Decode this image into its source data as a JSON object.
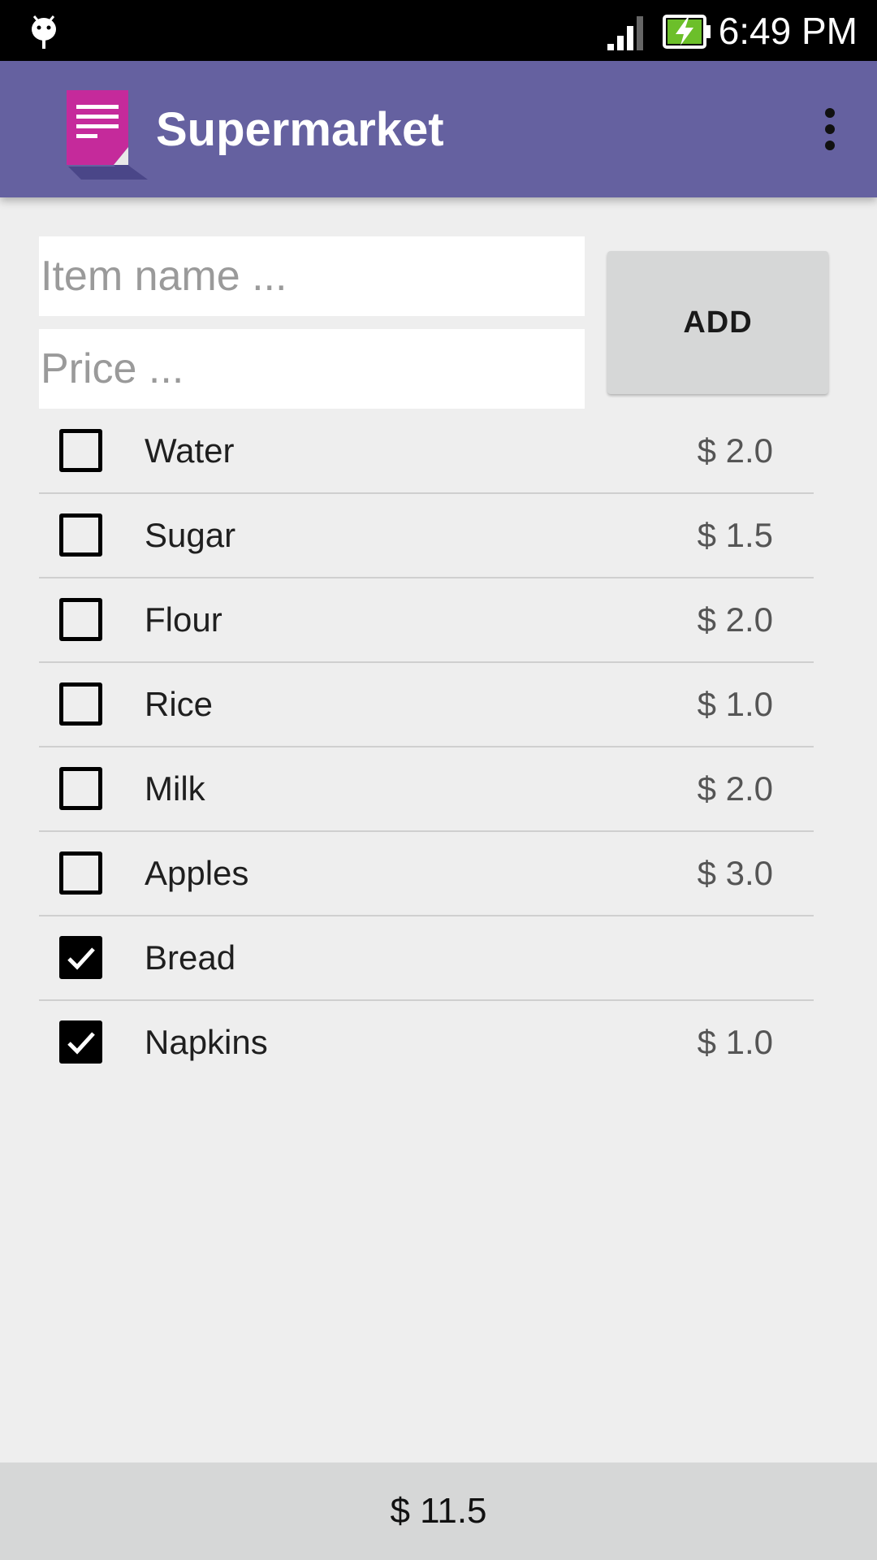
{
  "status_bar": {
    "time": "6:49 PM",
    "icons": [
      "debug-icon",
      "signal-icon",
      "battery-charging-icon"
    ]
  },
  "app_bar": {
    "title": "Supermarket",
    "icons": [
      "app-notes-icon",
      "overflow-menu-icon"
    ]
  },
  "form": {
    "item_placeholder": "Item name ...",
    "price_placeholder": "Price ...",
    "add_label": "ADD"
  },
  "items": [
    {
      "name": "Water",
      "price": "$ 2.0",
      "checked": false
    },
    {
      "name": "Sugar",
      "price": "$ 1.5",
      "checked": false
    },
    {
      "name": "Flour",
      "price": "$ 2.0",
      "checked": false
    },
    {
      "name": "Rice",
      "price": "$ 1.0",
      "checked": false
    },
    {
      "name": "Milk",
      "price": "$ 2.0",
      "checked": false
    },
    {
      "name": "Apples",
      "price": "$ 3.0",
      "checked": false
    },
    {
      "name": "Bread",
      "price": "",
      "checked": true
    },
    {
      "name": "Napkins",
      "price": "$ 1.0",
      "checked": true
    }
  ],
  "footer": {
    "total": "$ 11.5"
  },
  "colors": {
    "app_bar": "#6561a0",
    "icon_pink": "#c52a9b",
    "background": "#eeeeee",
    "button": "#d6d7d7"
  }
}
